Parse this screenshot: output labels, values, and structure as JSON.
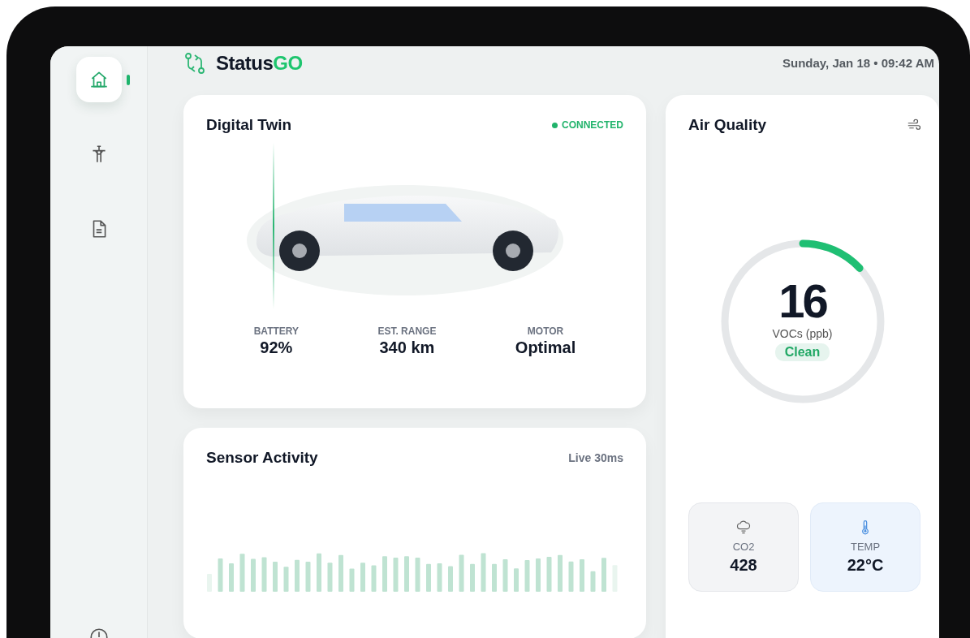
{
  "header": {
    "brand": {
      "name": "Status",
      "accent": "GO"
    },
    "datetime": "Sunday, Jan 18 • 09:42 AM"
  },
  "sidebar": {
    "items": [
      {
        "kind": "home",
        "selected": true
      },
      {
        "kind": "tower",
        "selected": false
      },
      {
        "kind": "document",
        "selected": false
      },
      {
        "kind": "clock",
        "selected": false
      }
    ]
  },
  "digital_twin": {
    "title": "Digital Twin",
    "status": "CONNECTED",
    "connected": true,
    "stats": [
      {
        "label": "BATTERY",
        "value": "92%"
      },
      {
        "label": "EST. RANGE",
        "value": "340 km"
      },
      {
        "label": "MOTOR",
        "value": "Optimal"
      }
    ]
  },
  "sensor_activity": {
    "title": "Sensor Activity",
    "badge": "Live 30ms"
  },
  "air_quality": {
    "title": "Air Quality",
    "gauge": {
      "value": "16",
      "unit": "VOCs (ppb)",
      "status": "Clean",
      "level": 0.13
    },
    "tiles": [
      {
        "kind": "co2",
        "label": "CO2",
        "value": "428"
      },
      {
        "kind": "temp",
        "label": "TEMP",
        "value": "22°C"
      }
    ]
  }
}
